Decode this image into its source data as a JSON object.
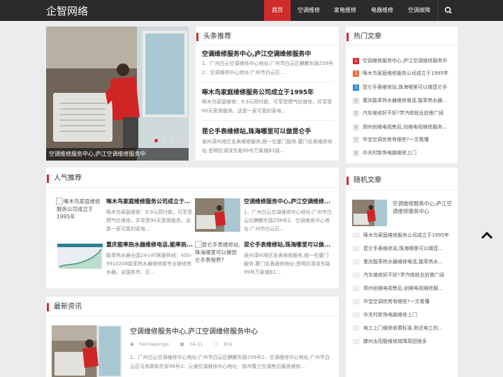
{
  "site": {
    "logo": "企智网络"
  },
  "nav": {
    "items": [
      {
        "label": "首页",
        "active": true
      },
      {
        "label": "空调维修"
      },
      {
        "label": "家电维修"
      },
      {
        "label": "电器维修"
      },
      {
        "label": "空调故障"
      }
    ],
    "search_icon": "search-icon"
  },
  "hero": {
    "caption": "空调维修服务中心,庐江空调维修服务中",
    "slides": 4,
    "active_slide": 1
  },
  "headlines": {
    "title": "头条推荐",
    "items": [
      {
        "title": "空调维修服务中心,庐江空调维修服务中",
        "desc": "1、广州白云空调维修中心地址:广州市白云区麒麟东路258号2、空调维修中心地址:广州市白云区..."
      },
      {
        "title": "啄木鸟家庭维修服务公司成立于1995年",
        "desc": "啄木鸟家庭维修：9.9元预付款，可享受燃气灶维修，并享受90天质保服务。这是一家可靠的家电..."
      },
      {
        "title": "昆仑手表维修站,珠海哪里可以做昆仑手",
        "desc": "泉州漳州地区名表维修服务,统一在厦门服务.厦门名表维修地址:思明区湖滨东路99号万象城B1层..."
      }
    ]
  },
  "hot": {
    "title": "热门文章",
    "items": [
      "空调维修服务中心,庐江空调维修服务中",
      "啄木鸟家庭维修服务公司成立于1995年",
      "昆仑手表维修站,珠海哪里可以做昆仑手",
      "重庆能率热水器维修电话,能率热水器...",
      "汽车维修好不好?学汽修就业前景广阔",
      "郑州创维电视售后,创维电视维修服务...",
      "华宝空调优势有哪些?一文看懂",
      "中关村新饰电脑维修上门"
    ]
  },
  "popular": {
    "title": "人气推荐",
    "items": [
      {
        "alt": "啄木鸟家庭维修服务公司成立于1995年",
        "title": "啄木鸟家庭维修服务公司成立于1...",
        "desc": "啄木鸟家庭维修：9.9元预付款，可享受燃气灶维修，并享受90天质保服务。这是一家可靠的家电..."
      },
      {
        "title": "空调维修服务中心,庐江空调维修...",
        "desc": "1、广州白云空调维修中心地址:广州市白云区麒麟东路258号2、空调维修中心地址:广州市白云区..."
      },
      {
        "title": "重庆能率热水器维修电话,能率热...",
        "desc": "能率热水器全国24小时客服热线：400-9910208能率热水器维修部专业维修热水器。全国各市、区..."
      },
      {
        "alt": "昆仑手表维修站,珠海哪里可以做昆仑手表保养?",
        "title": "昆仑手表维修站,珠海哪里可以做...",
        "desc": "泉州漳州地区名表维修服务,统一在厦门服务.厦门名表维修地址:思明区湖滨东路99号万象城B1..."
      }
    ]
  },
  "random": {
    "title": "随机文章",
    "top_item": "空调维修服务中心,庐江空调维修服务中心",
    "items": [
      "啄木鸟家庭维修服务公司成立于1995年",
      "昆仑手表维修站,珠海哪里可以做昆...",
      "重庆能率热水器维修电话,能率热水...",
      "汽车维修好不好?学汽修就业前景广阔",
      "郑州创维电视售后,创维电视维修服...",
      "华宝空调优势有哪些?一文看懂",
      "中关村新饰电脑维修上门",
      "电工上门维修收费标准,附近电工的...",
      "滕州太阳能维修故障原因很多"
    ]
  },
  "latest": {
    "title": "最新资讯",
    "items": [
      {
        "title": "空调维修服务中心,庐江空调维修服务中心",
        "author": "heimagongsi",
        "date": "04-11",
        "views": "832",
        "desc": "1、广州白云空调维修中心地址:广州市白云区麒麟东路258号2、空调维修中心地址:广州市白云区马务联和东街96号3、元通空调维修中心地址：徐州春兰空调售后服务维修..."
      }
    ]
  },
  "colors": {
    "accent": "#d12b2b",
    "header_bg": "#2b2b2b",
    "page_bg": "#ececec"
  },
  "icons": {
    "back_to_top": "chevron-up-icon",
    "user": "user-icon",
    "calendar": "calendar-icon",
    "eye": "eye-icon"
  }
}
